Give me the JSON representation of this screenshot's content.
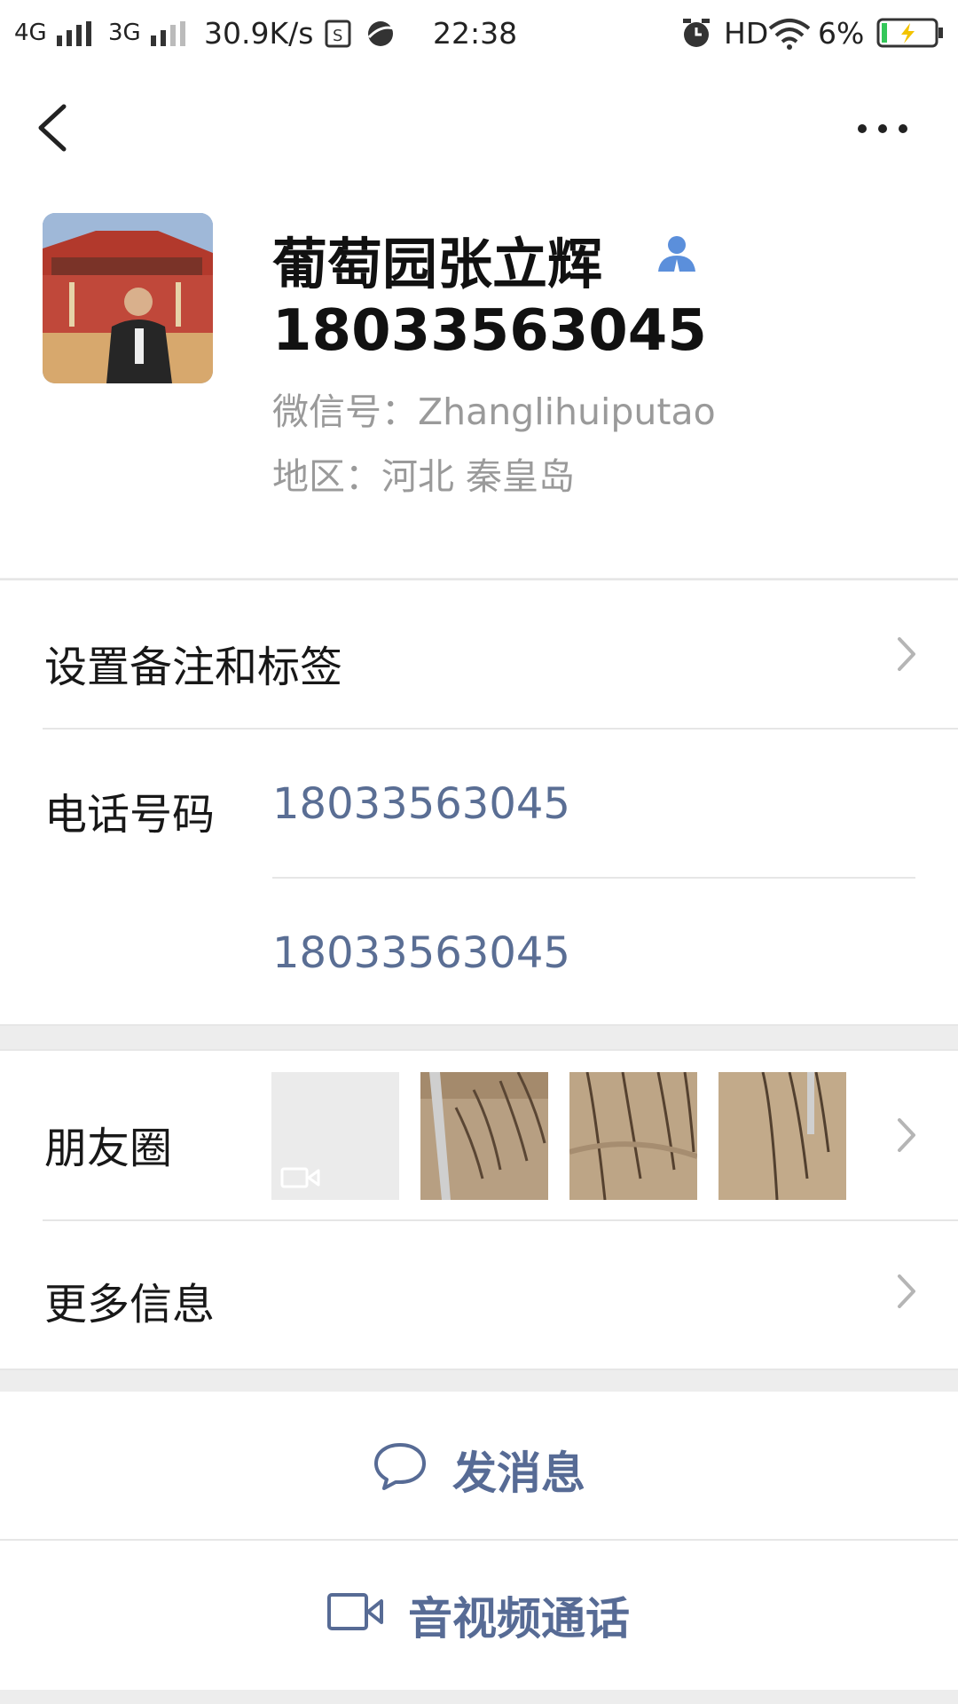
{
  "status_bar": {
    "network_1": "4G",
    "network_2": "3G",
    "speed": "30.9K/s",
    "time": "22:38",
    "hd": "HD",
    "battery": "6%"
  },
  "nav": {
    "back_icon": "chevron-left-icon",
    "more_icon": "more-dots-icon"
  },
  "profile": {
    "name": "葡萄园张立辉",
    "phone": "18033563045",
    "wechat_id": "微信号：Zhanglihuiputao",
    "region": "地区：河北  秦皇岛"
  },
  "rows": {
    "remark_label": "设置备注和标签",
    "phone_label": "电话号码",
    "phone_1": "18033563045",
    "phone_2": "18033563045",
    "moments_label": "朋友圈",
    "more_info_label": "更多信息"
  },
  "actions": {
    "message": "发消息",
    "call": "音视频通话"
  },
  "colors": {
    "link": "#576b95",
    "background": "#ededed"
  }
}
